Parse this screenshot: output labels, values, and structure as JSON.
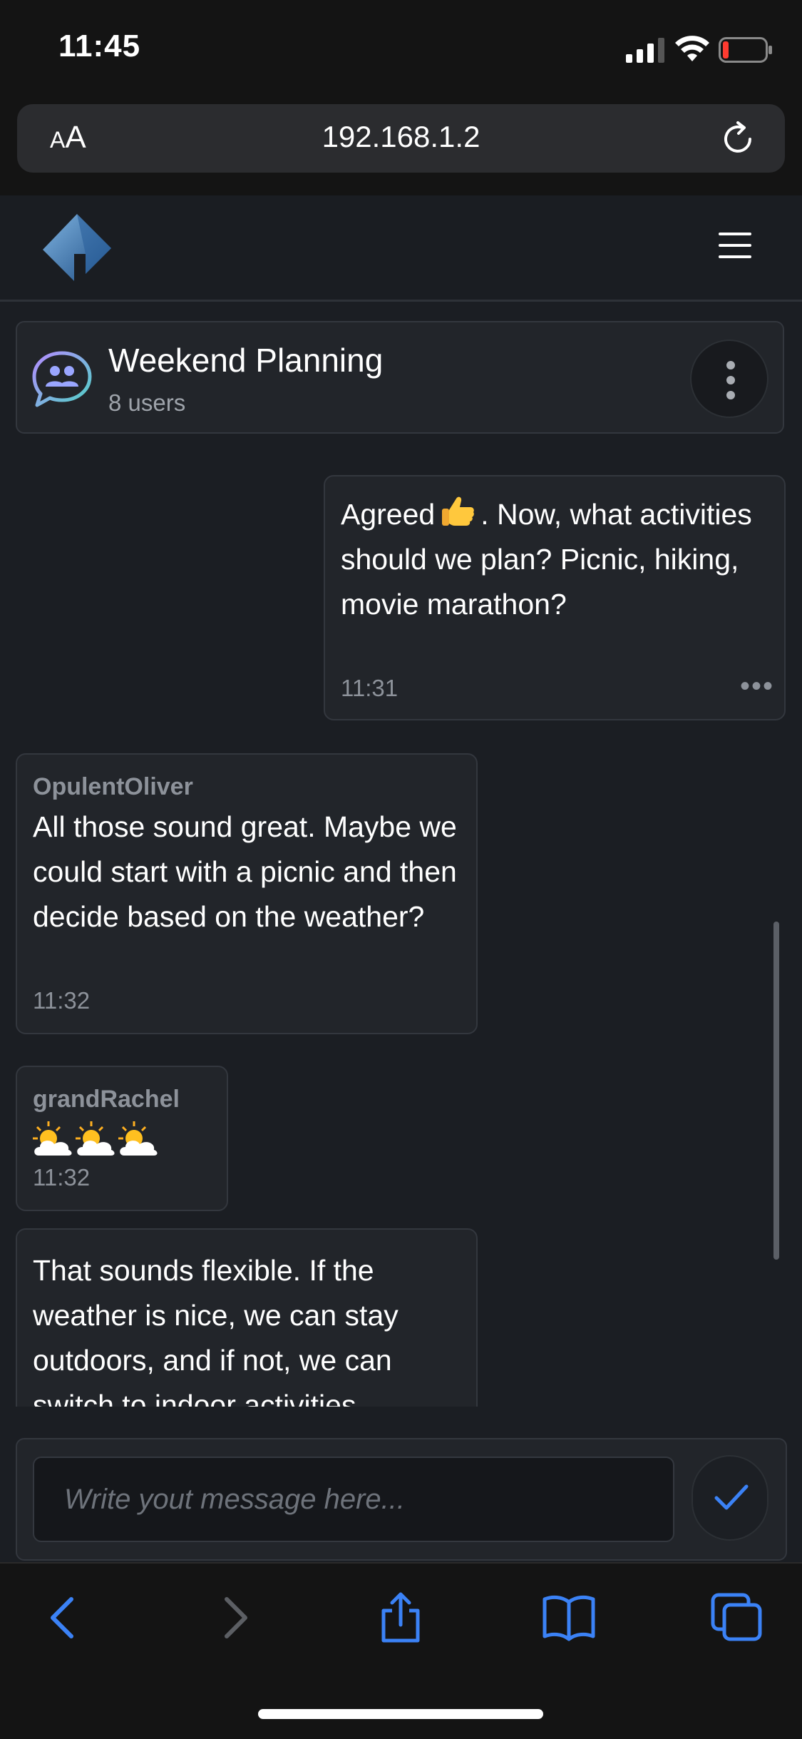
{
  "status_bar": {
    "time": "11:45"
  },
  "browser": {
    "aa_label_small": "A",
    "aa_label_big": "A",
    "url": "192.168.1.2"
  },
  "chat": {
    "title": "Weekend Planning",
    "users": "8 users"
  },
  "messages": [
    {
      "author": "",
      "text_before": "Agreed",
      "text_after": ". Now, what activities should we plan? Picnic, hiking, movie marathon?",
      "time": "11:31",
      "outgoing": true,
      "more": "•••"
    },
    {
      "author": "OpulentOliver",
      "text": "All those sound great. Maybe we could start with a picnic and then decide based on the weather?",
      "time": "11:32"
    },
    {
      "author": "grandRachel",
      "emoji": [
        "sun-behind-cloud",
        "sun-behind-cloud",
        "sun-behind-cloud"
      ],
      "time": "11:32"
    },
    {
      "author": "",
      "text": "That sounds flexible. If the weather is nice, we can stay outdoors, and if not, we can switch to indoor activities."
    }
  ],
  "composer": {
    "placeholder": "Write yout message here..."
  },
  "colors": {
    "accent": "#3b82f6",
    "background": "#1b1e23",
    "card": "#22252a"
  }
}
